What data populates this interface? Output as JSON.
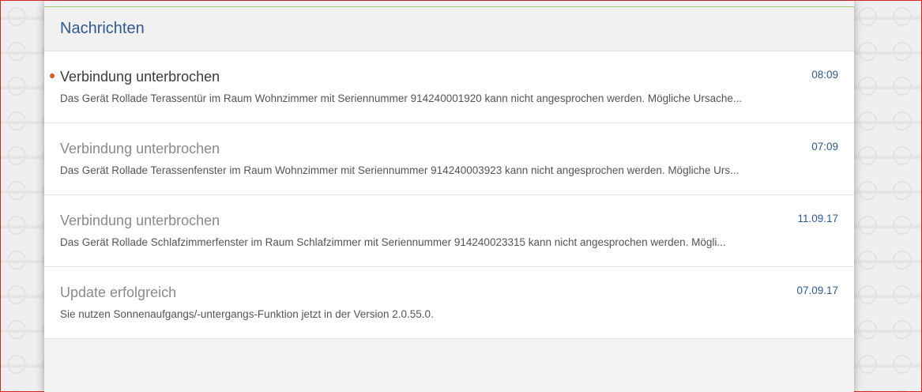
{
  "panel": {
    "title": "Nachrichten"
  },
  "messages": [
    {
      "title": "Verbindung unterbrochen",
      "body": "Das Gerät Rollade Terassentür im Raum Wohnzimmer mit Seriennummer 914240001920 kann nicht angesprochen werden. Mögliche Ursache...",
      "time": "08:09",
      "unread": true
    },
    {
      "title": "Verbindung unterbrochen",
      "body": "Das Gerät Rollade Terassenfenster im Raum Wohnzimmer mit Seriennummer 914240003923 kann nicht angesprochen werden. Mögliche Urs...",
      "time": "07:09",
      "unread": false
    },
    {
      "title": "Verbindung unterbrochen",
      "body": "Das Gerät Rollade Schlafzimmerfenster im Raum Schlafzimmer mit Seriennummer 914240023315 kann nicht angesprochen werden. Mögli...",
      "time": "11.09.17",
      "unread": false
    },
    {
      "title": "Update erfolgreich",
      "body": "Sie nutzen Sonnenaufgangs/-untergangs-Funktion jetzt in der Version 2.0.55.0.",
      "time": "07.09.17",
      "unread": false
    }
  ],
  "colors": {
    "accent": "#2f5a8f",
    "unread_dot": "#e2532c",
    "topline": "#9ccc78"
  }
}
